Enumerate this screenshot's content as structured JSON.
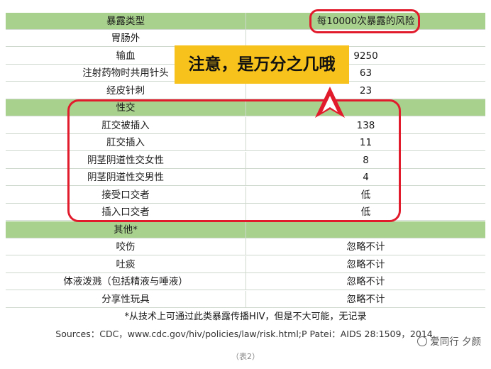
{
  "header": {
    "col1": "暴露类型",
    "col2": "每10000次暴露的风险"
  },
  "rows": [
    {
      "kind": "white",
      "c1": "胃肠外",
      "c2": ""
    },
    {
      "kind": "white",
      "c1": "输血",
      "c2": "9250"
    },
    {
      "kind": "white",
      "c1": "注射药物时共用针头",
      "c2": "63"
    },
    {
      "kind": "white",
      "c1": "经皮针刺",
      "c2": "23"
    },
    {
      "kind": "green",
      "c1": "性交",
      "c2": ""
    },
    {
      "kind": "white",
      "c1": "肛交被插入",
      "c2": "138"
    },
    {
      "kind": "white",
      "c1": "肛交插入",
      "c2": "11"
    },
    {
      "kind": "white",
      "c1": "阴茎阴道性交女性",
      "c2": "8"
    },
    {
      "kind": "white",
      "c1": "阴茎阴道性交男性",
      "c2": "4"
    },
    {
      "kind": "white",
      "c1": "接受口交者",
      "c2": "低"
    },
    {
      "kind": "white",
      "c1": "插入口交者",
      "c2": "低"
    },
    {
      "kind": "green",
      "c1": "其他*",
      "c2": ""
    },
    {
      "kind": "white",
      "c1": "咬伤",
      "c2": "忽略不计"
    },
    {
      "kind": "white",
      "c1": "吐痰",
      "c2": "忽略不计"
    },
    {
      "kind": "white",
      "c1": "体液泼溅（包括精液与唾液）",
      "c2": "忽略不计"
    },
    {
      "kind": "white",
      "c1": "分享性玩具",
      "c2": "忽略不计"
    }
  ],
  "note": "*从技术上可通过此类暴露传播HIV，但是不大可能，无记录",
  "sources": "Sources：CDC，www.cdc.gov/hiv/policies/law/risk.html;P Patei：AIDS 28:1509，2014.",
  "banner": "注意，是万分之几哦",
  "caption": "（表2）",
  "watermark": "爱同行 夕颜",
  "colors": {
    "header_green": "#a9d18e",
    "banner_yellow": "#f7c21b",
    "annotation_red": "#e21b2c"
  }
}
